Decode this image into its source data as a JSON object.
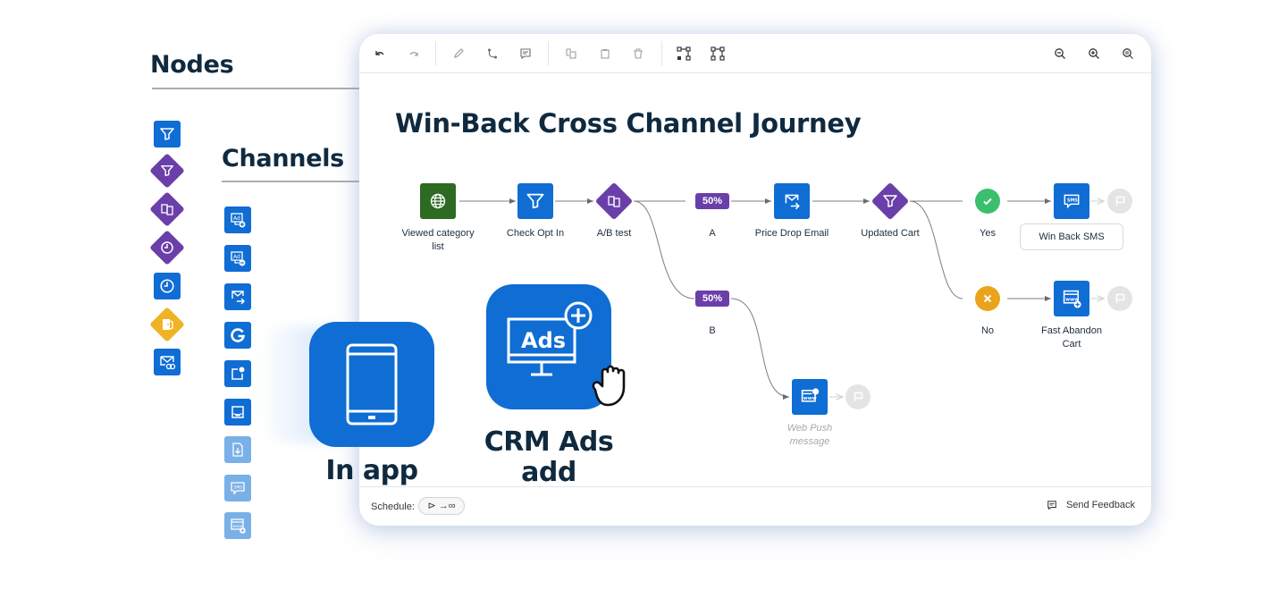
{
  "palette": {
    "nodes_heading": "Nodes",
    "channels_heading": "Channels",
    "node_icons": [
      "filter-icon",
      "decision-filter-icon",
      "ab-test-icon",
      "wait-icon",
      "timer-icon",
      "exit-icon",
      "email-verify-icon"
    ],
    "channel_icons": [
      "ad-add-icon",
      "ad-remove-icon",
      "email-send-icon",
      "google-icon",
      "push-notification-icon",
      "inbox-icon",
      "download-document-icon",
      "sms-icon",
      "web-push-add-icon"
    ]
  },
  "toolbar": {
    "left_tools": [
      "undo-icon",
      "redo-icon",
      "edit-icon",
      "connect-icon",
      "comment-icon",
      "copy-icon",
      "paste-icon",
      "delete-icon",
      "layout-auto-icon",
      "layout-grid-icon"
    ],
    "right_tools": [
      "zoom-out-icon",
      "zoom-in-icon",
      "zoom-fit-icon"
    ]
  },
  "journey": {
    "title": "Win-Back Cross Channel Journey",
    "nodes": {
      "viewed_category": "Viewed category\nlist",
      "check_opt_in": "Check Opt In",
      "ab_test": "A/B test",
      "split_a_pct": "50%",
      "split_a": "A",
      "split_b_pct": "50%",
      "split_b": "B",
      "price_drop_email": "Price Drop Email",
      "updated_cart": "Updated Cart",
      "yes": "Yes",
      "no": "No",
      "win_back_sms": "Win Back SMS",
      "fast_abandon_cart": "Fast Abandon\nCart",
      "web_push": "Web Push\nmessage"
    },
    "colors": {
      "channel_blue": "#0f6dd4",
      "decision_purple": "#6b3fa9",
      "trigger_green": "#2d6a22",
      "yes_green": "#3bbf6c",
      "no_orange": "#eba31c",
      "end_gray": "#e4e4e4"
    }
  },
  "footer": {
    "schedule_label": "Schedule:",
    "schedule_value": "⊳ →∞",
    "feedback_label": "Send Feedback"
  },
  "featured": {
    "in_app_label": "In app",
    "crm_ads_label": "CRM Ads\nadd",
    "crm_ads_icon_text": "Ads"
  }
}
